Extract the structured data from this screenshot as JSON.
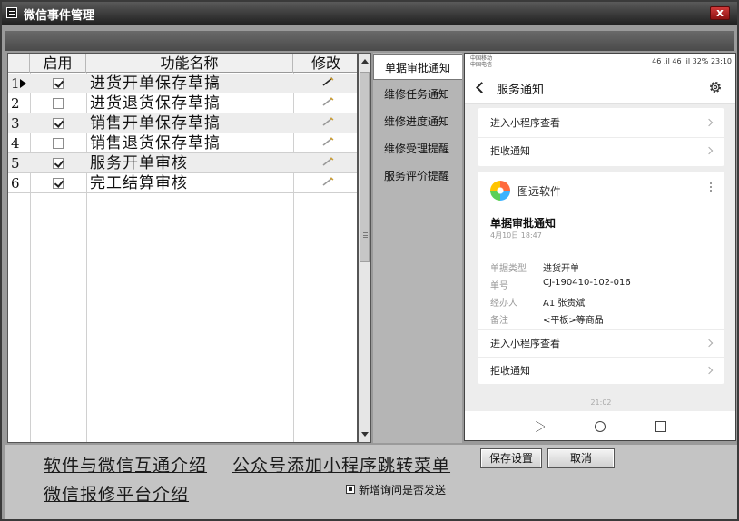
{
  "window": {
    "title": "微信事件管理",
    "close_label": "x"
  },
  "grid": {
    "headers": {
      "enabled": "启用",
      "name": "功能名称",
      "edit": "修改"
    },
    "rows": [
      {
        "num": "1",
        "enabled": true,
        "name": "进货开单保存草搞"
      },
      {
        "num": "2",
        "enabled": false,
        "name": "进货退货保存草搞"
      },
      {
        "num": "3",
        "enabled": true,
        "name": "销售开单保存草搞"
      },
      {
        "num": "4",
        "enabled": false,
        "name": "销售退货保存草搞"
      },
      {
        "num": "5",
        "enabled": true,
        "name": "服务开单审核"
      },
      {
        "num": "6",
        "enabled": true,
        "name": "完工结算审核"
      }
    ],
    "current_row": 1
  },
  "tabs": [
    {
      "label": "单据审批通知",
      "selected": true
    },
    {
      "label": "维修任务通知",
      "selected": false
    },
    {
      "label": "维修进度通知",
      "selected": false
    },
    {
      "label": "维修受理提醒",
      "selected": false
    },
    {
      "label": "服务评价提醒",
      "selected": false
    }
  ],
  "phone": {
    "carrier_1": "中国移动",
    "carrier_2": "中国电信",
    "status_right": "46 .il 46 .il 32% 23:10",
    "nav_title": "服务通知",
    "top_card": {
      "link_1": "进入小程序查看",
      "link_2": "拒收通知"
    },
    "msg_card": {
      "brand": "图远软件",
      "title": "单据审批通知",
      "date": "4月10日 18:47",
      "fields": [
        {
          "key": "单据类型",
          "value": "进货开单"
        },
        {
          "key": "单号",
          "value": "CJ-190410-102-016"
        },
        {
          "key": "经办人",
          "value": "A1 张贵斌"
        },
        {
          "key": "备注",
          "value": "<平板>等商品"
        }
      ],
      "link_1": "进入小程序查看",
      "link_2": "拒收通知"
    },
    "time": "21:02"
  },
  "bottom": {
    "link_intro": "软件与微信互通介绍",
    "link_menu": "公众号添加小程序跳转菜单",
    "link_repair": "微信报修平台介绍",
    "save_button": "保存设置",
    "cancel_button": "取消",
    "checkbox_label": "新增询问是否发送"
  }
}
